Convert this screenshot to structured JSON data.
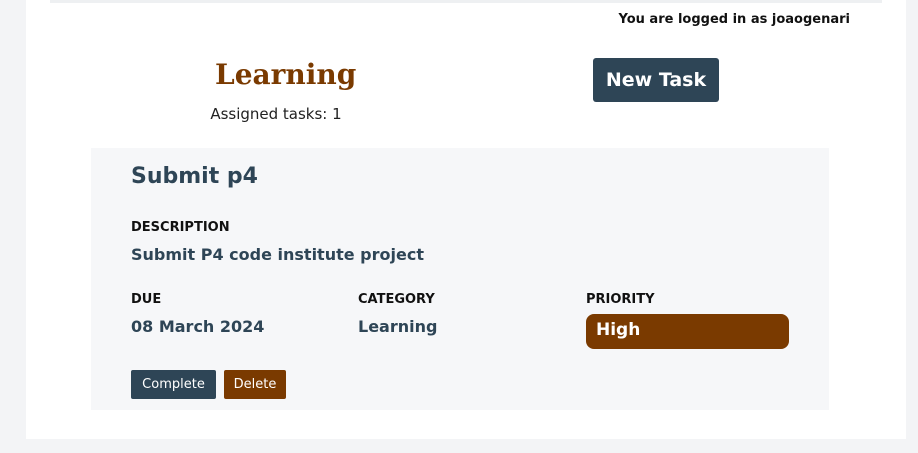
{
  "header": {
    "login_status": "You are logged in as joaogenari"
  },
  "category": {
    "title": "Learning",
    "assigned_text": "Assigned tasks: 1"
  },
  "actions": {
    "new_task_label": "New Task"
  },
  "task": {
    "title": "Submit p4",
    "description_label": "DESCRIPTION",
    "description": "Submit P4 code institute project",
    "due_label": "DUE",
    "due": "08 March 2024",
    "category_label": "CATEGORY",
    "category": "Learning",
    "priority_label": "PRIORITY",
    "priority": "High",
    "complete_label": "Complete",
    "delete_label": "Delete"
  },
  "colors": {
    "brand_dark": "#2e4556",
    "accent_brown": "#7a3a00",
    "card_bg": "#f6f7f9"
  }
}
